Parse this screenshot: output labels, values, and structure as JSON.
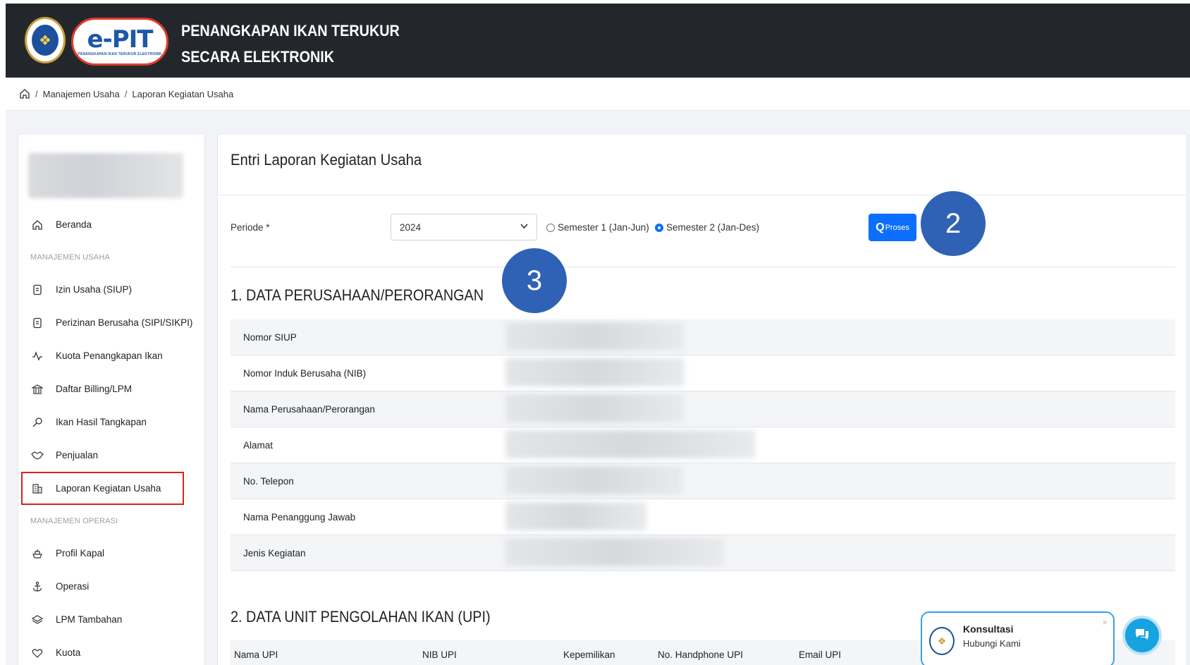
{
  "header": {
    "logo_brand": "e-PIT",
    "logo_tagline": "PENANGKAPAN IKAN TERUKUR ELEKTRONIK",
    "title_line1": "PENANGKAPAN IKAN TERUKUR",
    "title_line2": "SECARA ELEKTRONIK"
  },
  "breadcrumb": {
    "sep": "/",
    "items": [
      "Manajemen Usaha",
      "Laporan Kegiatan Usaha"
    ]
  },
  "sidebar": {
    "items": [
      {
        "label": "Beranda",
        "icon": "home-icon"
      },
      {
        "section": "MANAJEMEN USAHA"
      },
      {
        "label": "Izin Usaha (SIUP)",
        "icon": "document-icon"
      },
      {
        "label": "Perizinan Berusaha (SIPI/SIKPI)",
        "icon": "document-icon"
      },
      {
        "label": "Kuota Penangkapan Ikan",
        "icon": "activity-icon"
      },
      {
        "label": "Daftar Billing/LPM",
        "icon": "bank-icon"
      },
      {
        "label": "Ikan Hasil Tangkapan",
        "icon": "fishing-icon"
      },
      {
        "label": "Penjualan",
        "icon": "handshake-icon"
      },
      {
        "label": "Laporan Kegiatan Usaha",
        "icon": "building-icon",
        "active": true
      },
      {
        "section": "MANAJEMEN OPERASI"
      },
      {
        "label": "Profil Kapal",
        "icon": "ship-icon"
      },
      {
        "label": "Operasi",
        "icon": "anchor-icon"
      },
      {
        "label": "LPM Tambahan",
        "icon": "layers-icon"
      },
      {
        "label": "Kuota",
        "icon": "heart-icon"
      }
    ]
  },
  "main": {
    "title": "Entri Laporan Kegiatan Usaha",
    "periode_label": "Periode *",
    "periode_value": "2024",
    "semester1_label": "Semester 1 (Jan-Jun)",
    "semester2_label": "Semester 2 (Jan-Des)",
    "semester_selected": 2,
    "proses_label": "Proses",
    "section1_title": "1. DATA PERUSAHAAN/PERORANGAN",
    "fields": [
      {
        "label": "Nomor SIUP"
      },
      {
        "label": "Nomor Induk Berusaha (NIB)"
      },
      {
        "label": "Nama Perusahaan/Perorangan"
      },
      {
        "label": "Alamat"
      },
      {
        "label": "No. Telepon"
      },
      {
        "label": "Nama Penanggung Jawab"
      },
      {
        "label": "Jenis Kegiatan"
      }
    ],
    "section2_title": "2. DATA UNIT PENGOLAHAN IKAN (UPI)",
    "upi_columns": [
      "Nama UPI",
      "NIB UPI",
      "Kepemilikan",
      "No. Handphone UPI",
      "Email UPI"
    ]
  },
  "annotations": {
    "step2": "2",
    "step3": "3"
  },
  "chat": {
    "title": "Konsultasi",
    "subtitle": "Hubungi Kami",
    "close": "×"
  },
  "colors": {
    "header_bg": "#23272c",
    "primary": "#0d6efd",
    "badge": "#2f62b4",
    "active_outline": "#e01e1e",
    "chat": "#16a3e0"
  }
}
